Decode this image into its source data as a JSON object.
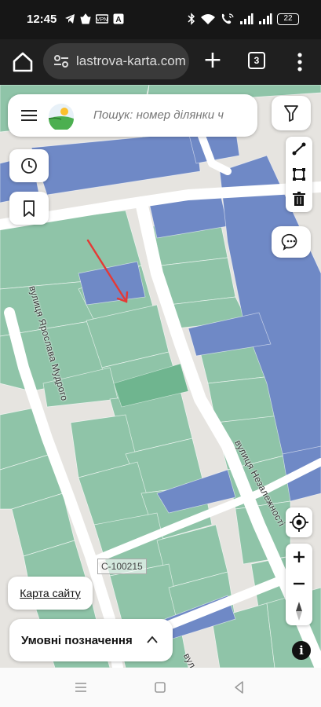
{
  "status_bar": {
    "time": "12:45",
    "left_icons": [
      "telegram-icon",
      "basket-icon",
      "vpn-icon",
      "a-icon"
    ],
    "right_icons": [
      "bluetooth-icon",
      "wifi-icon",
      "wifi-call-icon",
      "signal-icon",
      "signal-icon"
    ],
    "battery": "22"
  },
  "browser": {
    "url": "lastrova-karta.com",
    "tab_count": "3"
  },
  "search": {
    "placeholder": "Пошук: номер ділянки ч"
  },
  "map": {
    "street_labels": [
      "вулиця Ярослава Мудрого",
      "вулиця Незалежності",
      "вул"
    ],
    "parcel_label": "C-100215",
    "colors": {
      "parcel_green": "#8fc4a8",
      "parcel_blue": "#6f89c6",
      "road": "#ffffff",
      "arrow": "#e53935"
    }
  },
  "controls": {
    "sitemap_label": "Карта сайту",
    "legend_label": "Умовні позначення",
    "info_label": "i"
  }
}
